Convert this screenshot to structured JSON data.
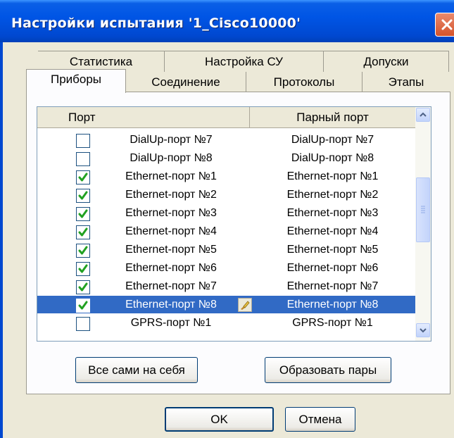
{
  "window": {
    "title": "Настройки испытания '1_Cisco10000'"
  },
  "tabs_back": [
    "Статистика",
    "Настройка СУ",
    "Допуски"
  ],
  "tabs_front": [
    "Приборы",
    "Соединение",
    "Протоколы",
    "Этапы"
  ],
  "active_tab": "Приборы",
  "grid": {
    "headers": {
      "port": "Порт",
      "pair": "Парный порт"
    },
    "rows": [
      {
        "port": "DialUp-порт №7",
        "pair": "DialUp-порт №7",
        "checked": false
      },
      {
        "port": "DialUp-порт №8",
        "pair": "DialUp-порт №8",
        "checked": false
      },
      {
        "port": "Ethernet-порт №1",
        "pair": "Ethernet-порт №1",
        "checked": true
      },
      {
        "port": "Ethernet-порт №2",
        "pair": "Ethernet-порт №2",
        "checked": true
      },
      {
        "port": "Ethernet-порт №3",
        "pair": "Ethernet-порт №3",
        "checked": true
      },
      {
        "port": "Ethernet-порт №4",
        "pair": "Ethernet-порт №4",
        "checked": true
      },
      {
        "port": "Ethernet-порт №5",
        "pair": "Ethernet-порт №5",
        "checked": true
      },
      {
        "port": "Ethernet-порт №6",
        "pair": "Ethernet-порт №6",
        "checked": true
      },
      {
        "port": "Ethernet-порт №7",
        "pair": "Ethernet-порт №7",
        "checked": true
      },
      {
        "port": "Ethernet-порт №8",
        "pair": "Ethernet-порт №8",
        "checked": true,
        "selected": true
      },
      {
        "port": "GPRS-порт №1",
        "pair": "GPRS-порт №1",
        "checked": false
      }
    ]
  },
  "buttons": {
    "all_self": "Все сами на себя",
    "make_pairs": "Образовать пары",
    "ok": "OK",
    "cancel": "Отмена"
  },
  "colors": {
    "titlebar": "#0055e5",
    "selection": "#316ac5",
    "check": "#21a121",
    "face": "#ece9d8"
  }
}
